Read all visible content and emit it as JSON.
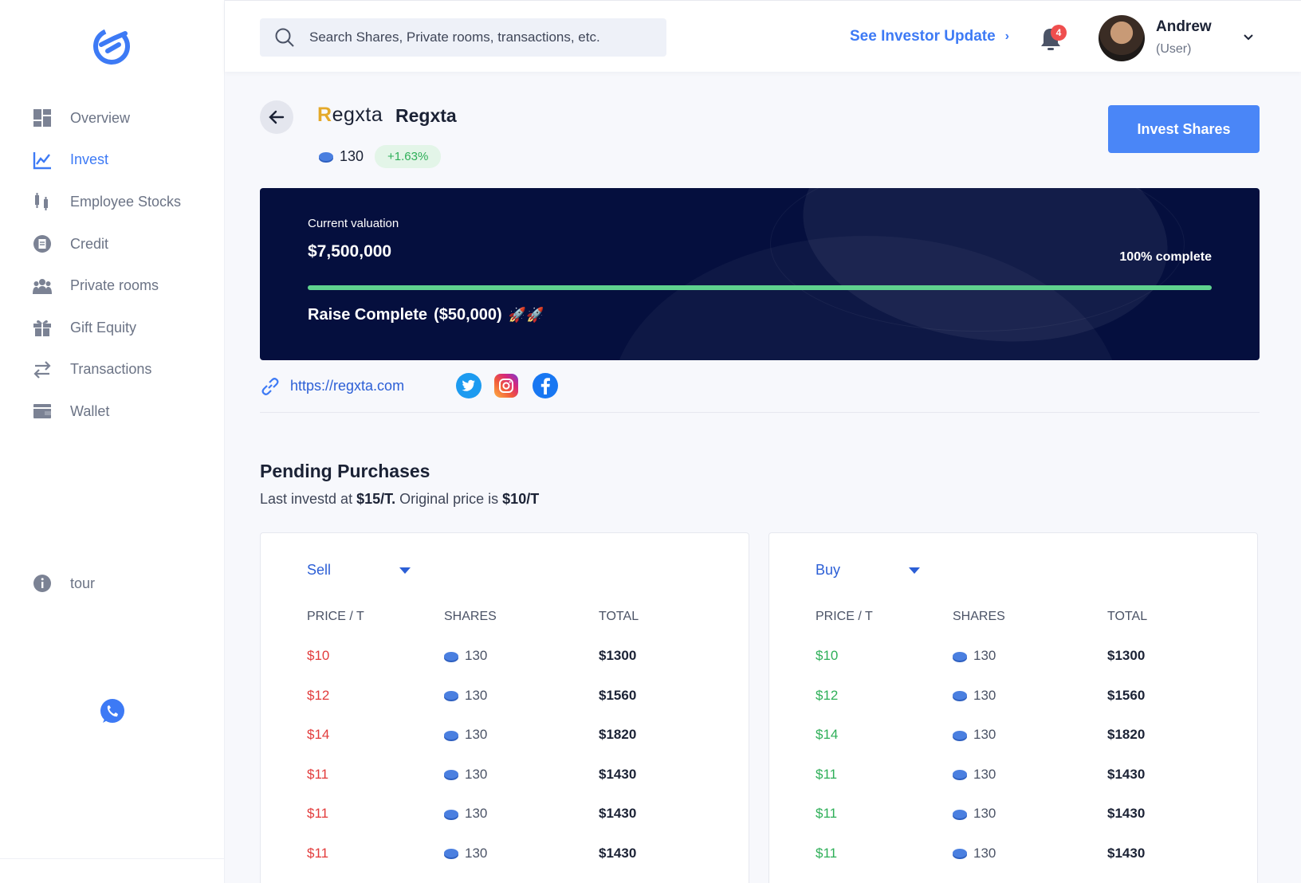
{
  "sidebar": {
    "items": [
      {
        "label": "Overview",
        "icon": "dashboard-icon",
        "active": false
      },
      {
        "label": "Invest",
        "icon": "chart-line-icon",
        "active": true
      },
      {
        "label": "Employee Stocks",
        "icon": "candlestick-icon",
        "active": false
      },
      {
        "label": "Credit",
        "icon": "document-icon",
        "active": false
      },
      {
        "label": "Private rooms",
        "icon": "group-icon",
        "active": false
      },
      {
        "label": "Gift Equity",
        "icon": "gift-icon",
        "active": false
      },
      {
        "label": "Transactions",
        "icon": "swap-arrows-icon",
        "active": false
      },
      {
        "label": "Wallet",
        "icon": "wallet-icon",
        "active": false
      }
    ],
    "tour_label": "tour"
  },
  "header": {
    "search_placeholder": "Search Shares, Private rooms, transactions, etc.",
    "investor_link": "See Investor Update",
    "notification_count": "4",
    "user_name": "Andrew",
    "user_role": "(User)"
  },
  "company": {
    "logo_text_first": "R",
    "logo_text_rest": "egxta",
    "name": "Regxta",
    "shares": "130",
    "change": "+1.63%",
    "invest_button": "Invest Shares"
  },
  "valuation": {
    "label": "Current valuation",
    "amount": "$7,500,000",
    "complete_text": "100% complete",
    "progress": 1.0,
    "raise_label": "Raise Complete",
    "raise_amount": "($50,000)",
    "rockets": "🚀🚀"
  },
  "links": {
    "website": "https://regxta.com"
  },
  "pending": {
    "title": "Pending Purchases",
    "sub_prefix": "Last investd at ",
    "last_price": "$15/T.",
    "sub_middle": " Original price is ",
    "original_price": "$10/T"
  },
  "table_headers": {
    "price": "PRICE / T",
    "shares": "SHARES",
    "total": "TOTAL"
  },
  "sell": {
    "dropdown": "Sell",
    "rows": [
      {
        "price": "$10",
        "shares": "130",
        "total": "$1300"
      },
      {
        "price": "$12",
        "shares": "130",
        "total": "$1560"
      },
      {
        "price": "$14",
        "shares": "130",
        "total": "$1820"
      },
      {
        "price": "$11",
        "shares": "130",
        "total": "$1430"
      },
      {
        "price": "$11",
        "shares": "130",
        "total": "$1430"
      },
      {
        "price": "$11",
        "shares": "130",
        "total": "$1430"
      }
    ]
  },
  "buy": {
    "dropdown": "Buy",
    "rows": [
      {
        "price": "$10",
        "shares": "130",
        "total": "$1300"
      },
      {
        "price": "$12",
        "shares": "130",
        "total": "$1560"
      },
      {
        "price": "$14",
        "shares": "130",
        "total": "$1820"
      },
      {
        "price": "$11",
        "shares": "130",
        "total": "$1430"
      },
      {
        "price": "$11",
        "shares": "130",
        "total": "$1430"
      },
      {
        "price": "$11",
        "shares": "130",
        "total": "$1430"
      }
    ]
  },
  "colors": {
    "accent": "#3d7af5",
    "banner": "#050f3e",
    "progress": "#5fd28e",
    "sell_price": "#e23b3b",
    "buy_price": "#2eaf58"
  }
}
